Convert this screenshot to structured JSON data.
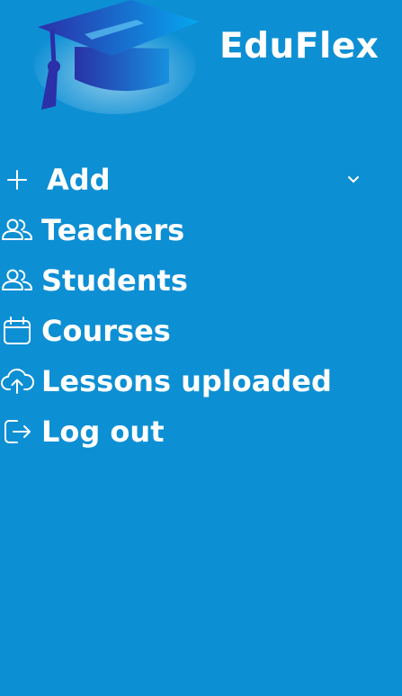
{
  "brand": {
    "name": "EduFlex",
    "logo_icon": "graduation-cap-icon"
  },
  "menu": {
    "items": [
      {
        "label": "Add",
        "icon": "plus-icon",
        "expandable": true
      },
      {
        "label": "Teachers",
        "icon": "users-icon"
      },
      {
        "label": "Students",
        "icon": "users-icon"
      },
      {
        "label": "Courses",
        "icon": "calendar-icon"
      },
      {
        "label": "Lessons uploaded",
        "icon": "cloud-upload-icon"
      },
      {
        "label": "Log out",
        "icon": "logout-icon"
      }
    ]
  },
  "colors": {
    "background": "#0d8fd4",
    "text": "#ffffff",
    "logo_dark": "#2b2fa8",
    "logo_light": "#00aaf0"
  }
}
